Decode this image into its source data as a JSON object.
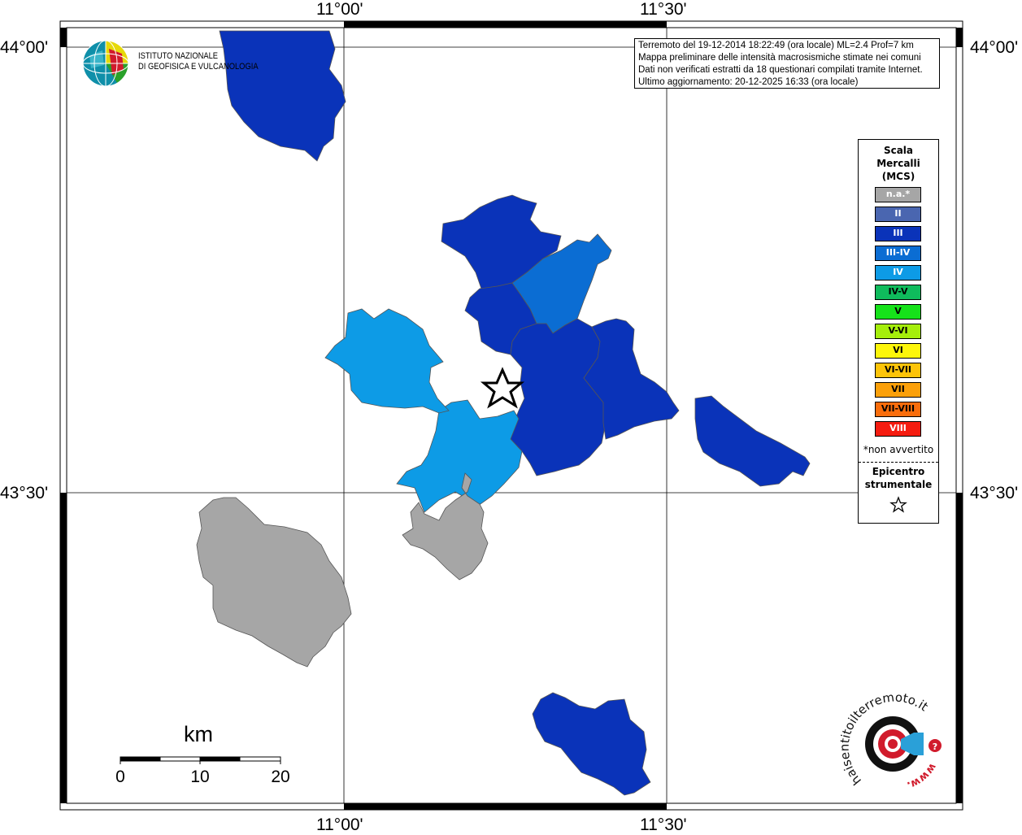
{
  "coords": {
    "top_left_lon": "11°00'",
    "top_right_lon": "11°30'",
    "bottom_left_lon": "11°00'",
    "bottom_right_lon": "11°30'",
    "left_upper_lat": "44°00'",
    "left_lower_lat": "43°30'",
    "right_upper_lat": "44°00'",
    "right_lower_lat": "43°30'"
  },
  "logo": {
    "line1": "ISTITUTO NAZIONALE",
    "line2": "DI GEOFISICA E VULCANOLOGIA"
  },
  "info": {
    "line1": "Terremoto del 19-12-2014 18:22:49 (ora locale) ML=2.4 Prof=7 km",
    "line2": "Mappa preliminare delle intensità macrosismiche stimate nei comuni",
    "line3": "Dati non verificati estratti da 18 questionari compilati tramite Internet.",
    "line4": "Ultimo aggiornamento: 20-12-2025 16:33 (ora locale)"
  },
  "legend": {
    "title1": "Scala",
    "title2": "Mercalli",
    "title3": "(MCS)",
    "items": [
      {
        "label": "n.a.*",
        "color": "#a6a6a6",
        "text_color": "#ffffff"
      },
      {
        "label": "II",
        "color": "#4a66b0",
        "text_color": "#ffffff"
      },
      {
        "label": "III",
        "color": "#0a33b9",
        "text_color": "#ffffff"
      },
      {
        "label": "III-IV",
        "color": "#0b6dd3",
        "text_color": "#ffffff"
      },
      {
        "label": "IV",
        "color": "#0d9be6",
        "text_color": "#ffffff"
      },
      {
        "label": "IV-V",
        "color": "#0fbb5c",
        "text_color": "#000000"
      },
      {
        "label": "V",
        "color": "#16e21a",
        "text_color": "#000000"
      },
      {
        "label": "V-VI",
        "color": "#a5ee0b",
        "text_color": "#000000"
      },
      {
        "label": "VI",
        "color": "#fdf60a",
        "text_color": "#000000"
      },
      {
        "label": "VI-VII",
        "color": "#fdc409",
        "text_color": "#000000"
      },
      {
        "label": "VII",
        "color": "#fba00a",
        "text_color": "#000000"
      },
      {
        "label": "VII-VIII",
        "color": "#f96d0c",
        "text_color": "#000000"
      },
      {
        "label": "VIII",
        "color": "#f51c10",
        "text_color": "#ffffff"
      }
    ],
    "note": "*non avvertito",
    "epicenter1": "Epicentro",
    "epicenter2": "strumentale"
  },
  "scale_bar": {
    "unit": "km",
    "ticks": [
      "0",
      "10",
      "20"
    ]
  },
  "municipalities": [
    {
      "intensity": "III",
      "color": "#0a33b9"
    },
    {
      "intensity": "III",
      "color": "#0a33b9"
    },
    {
      "intensity": "III",
      "color": "#0a33b9"
    },
    {
      "intensity": "III-IV",
      "color": "#0b6dd3"
    },
    {
      "intensity": "III",
      "color": "#0a33b9"
    },
    {
      "intensity": "III",
      "color": "#0a33b9"
    },
    {
      "intensity": "III",
      "color": "#0a33b9"
    },
    {
      "intensity": "IV",
      "color": "#0d9be6"
    },
    {
      "intensity": "IV",
      "color": "#0d9be6"
    },
    {
      "intensity": "n.a.*",
      "color": "#a6a6a6"
    },
    {
      "intensity": "n.a.*",
      "color": "#a6a6a6"
    },
    {
      "intensity": "III",
      "color": "#0a33b9"
    },
    {
      "intensity": "III",
      "color": "#0a33b9"
    }
  ],
  "hsit_logo": {
    "text1": "haisentitoilterremoto.it",
    "text2": "www.",
    "badge": "?"
  }
}
